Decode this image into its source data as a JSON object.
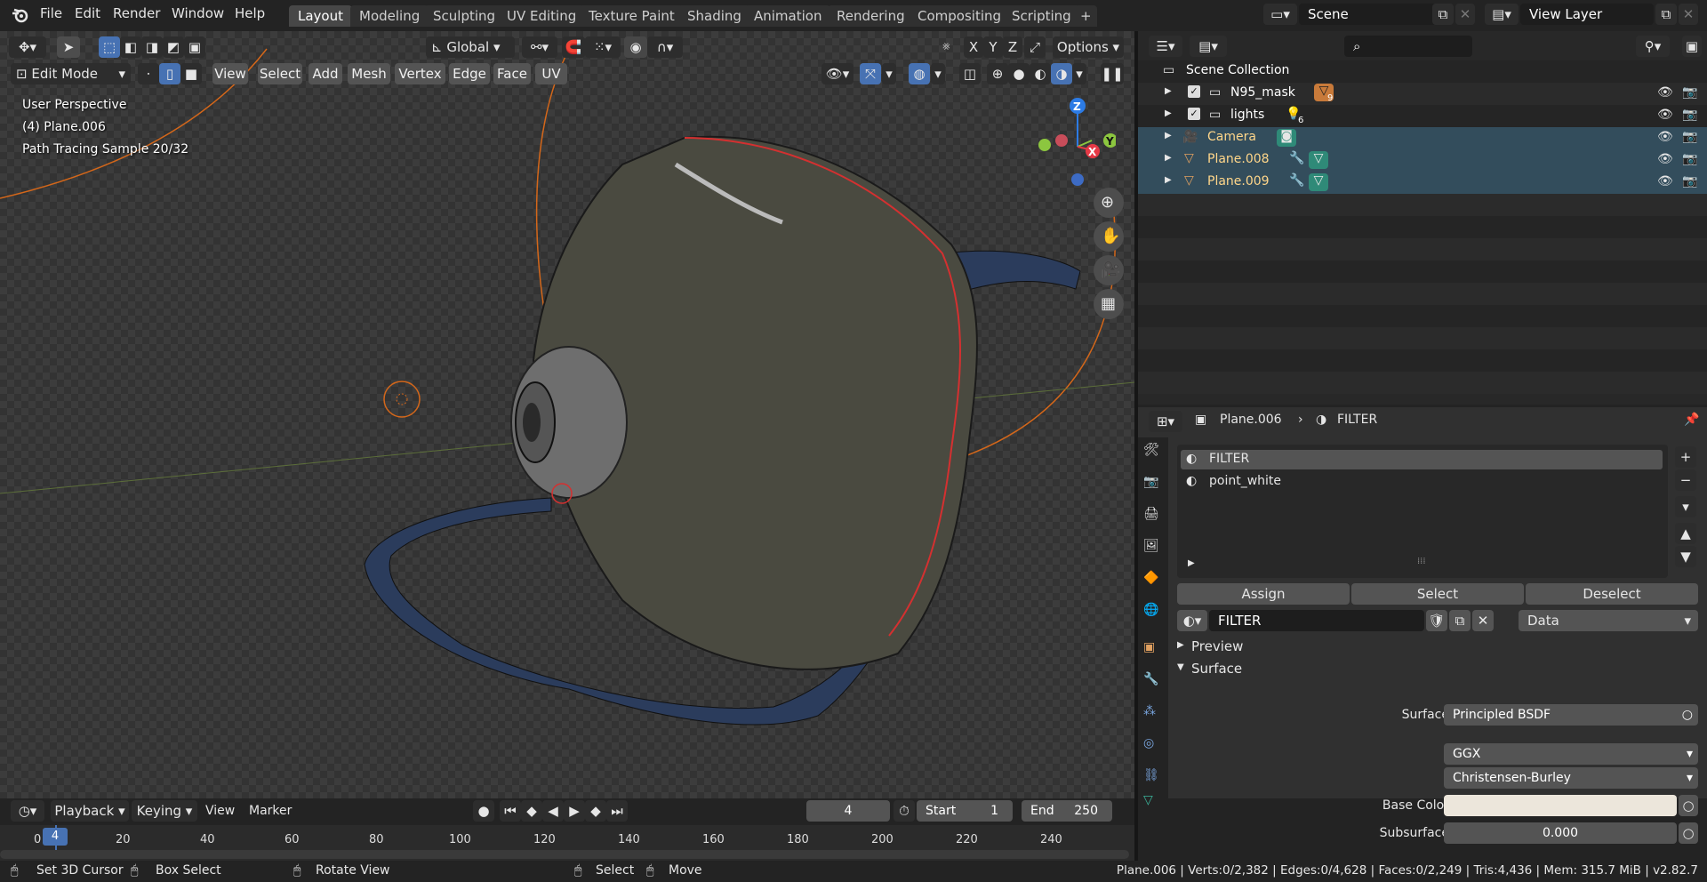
{
  "menu": {
    "file": "File",
    "edit": "Edit",
    "render": "Render",
    "window": "Window",
    "help": "Help"
  },
  "workspaces": [
    "Layout",
    "Modeling",
    "Sculpting",
    "UV Editing",
    "Texture Paint",
    "Shading",
    "Animation",
    "Rendering",
    "Compositing",
    "Scripting"
  ],
  "active_workspace": "Layout",
  "scene": {
    "name": "Scene",
    "view_layer": "View Layer"
  },
  "viewport_header": {
    "transform_orientation": "Global",
    "mode": "Edit Mode",
    "menus": [
      "View",
      "Select",
      "Add",
      "Mesh",
      "Vertex",
      "Edge",
      "Face",
      "UV"
    ],
    "options": "Options",
    "axes": [
      "X",
      "Y",
      "Z"
    ]
  },
  "overlay": {
    "perspective": "User Perspective",
    "object": "(4) Plane.006",
    "render": "Path Tracing Sample 20/32"
  },
  "gizmo": {
    "z": "Z",
    "y": "Y",
    "x": "X"
  },
  "outliner": {
    "root": "Scene Collection",
    "rows": [
      {
        "name": "N95_mask",
        "badge": "9",
        "type": "collection"
      },
      {
        "name": "lights",
        "badge": "6",
        "type": "collection"
      },
      {
        "name": "Camera",
        "type": "object"
      },
      {
        "name": "Plane.008",
        "type": "object"
      },
      {
        "name": "Plane.009",
        "type": "object"
      }
    ]
  },
  "properties": {
    "breadcrumb_object": "Plane.006",
    "breadcrumb_material": "FILTER",
    "slots": [
      "FILTER",
      "point_white"
    ],
    "assign": "Assign",
    "select": "Select",
    "deselect": "Deselect",
    "material_name": "FILTER",
    "link": "Data",
    "preview": "Preview",
    "surface_panel": "Surface",
    "surface_label": "Surface",
    "surface_value": "Principled BSDF",
    "distribution": "GGX",
    "subsurface_method": "Christensen-Burley",
    "base_color_label": "Base Color",
    "base_color": "#ece6db",
    "subsurface_label": "Subsurface",
    "subsurface_value": "0.000"
  },
  "timeline": {
    "menus": [
      "Playback",
      "Keying",
      "View",
      "Marker"
    ],
    "current_frame": "4",
    "start_label": "Start",
    "start": "1",
    "end_label": "End",
    "end": "250",
    "ruler": [
      "0",
      "20",
      "40",
      "60",
      "80",
      "100",
      "120",
      "140",
      "160",
      "180",
      "200",
      "220",
      "240"
    ],
    "cursor_frame": "4"
  },
  "statusbar": {
    "hints": [
      "Set 3D Cursor",
      "Box Select",
      "Rotate View",
      "Select",
      "Move"
    ],
    "stats": "Plane.006 | Verts:0/2,382 | Edges:0/4,628 | Faces:0/2,249 | Tris:4,436 | Mem: 315.7 MiB | v2.82.7"
  }
}
